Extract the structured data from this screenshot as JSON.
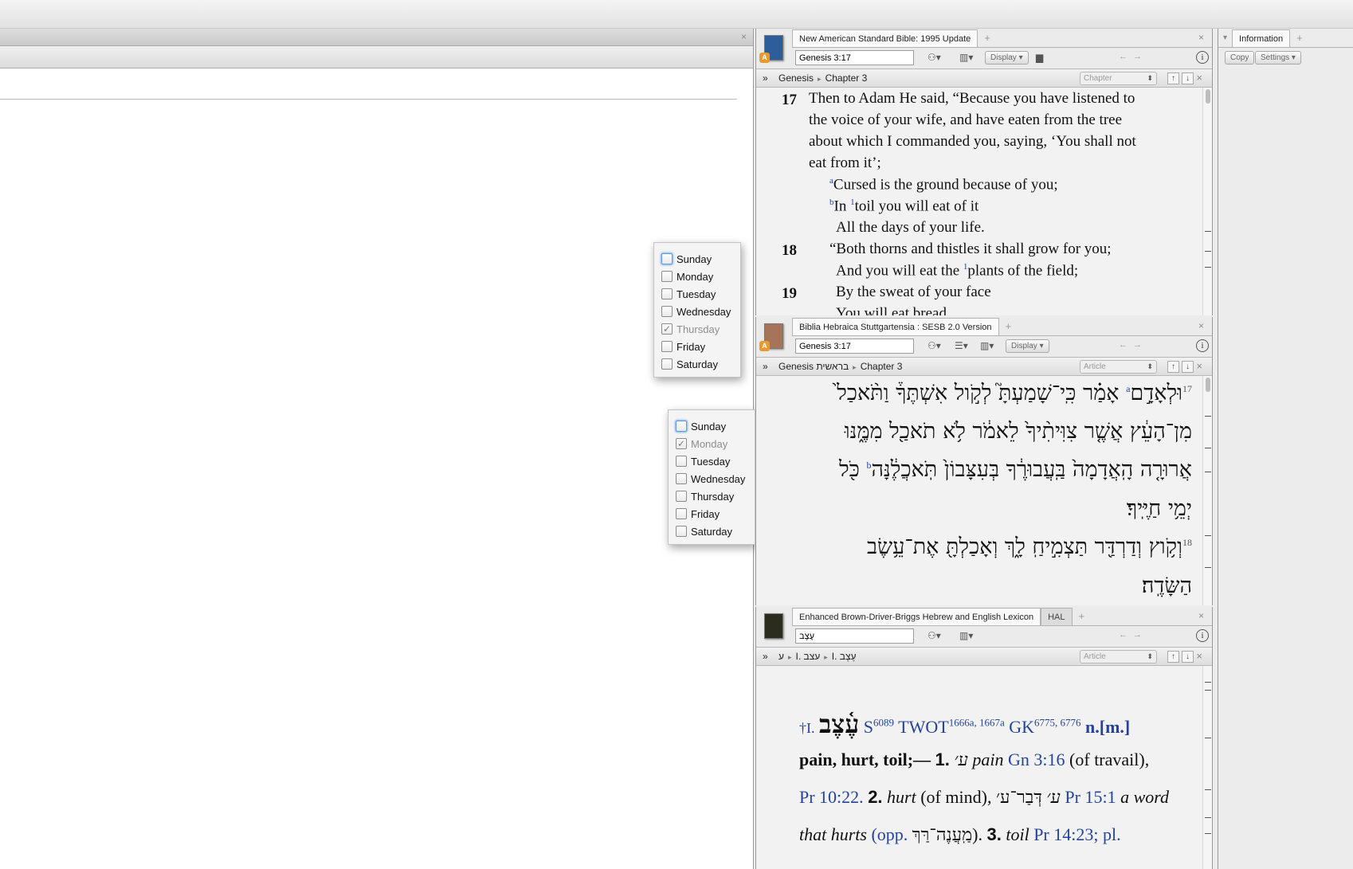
{
  "left_pane": {
    "close": "×"
  },
  "popups": [
    {
      "days": [
        {
          "label": "Sunday",
          "checked": false,
          "focus": true,
          "dim": false
        },
        {
          "label": "Monday",
          "checked": false,
          "focus": false,
          "dim": false
        },
        {
          "label": "Tuesday",
          "checked": false,
          "focus": false,
          "dim": false
        },
        {
          "label": "Wednesday",
          "checked": false,
          "focus": false,
          "dim": false
        },
        {
          "label": "Thursday",
          "checked": true,
          "focus": false,
          "dim": true
        },
        {
          "label": "Friday",
          "checked": false,
          "focus": false,
          "dim": false
        },
        {
          "label": "Saturday",
          "checked": false,
          "focus": false,
          "dim": false
        }
      ]
    },
    {
      "days": [
        {
          "label": "Sunday",
          "checked": false,
          "focus": true,
          "dim": false
        },
        {
          "label": "Monday",
          "checked": true,
          "focus": false,
          "dim": true
        },
        {
          "label": "Tuesday",
          "checked": false,
          "focus": false,
          "dim": false
        },
        {
          "label": "Wednesday",
          "checked": false,
          "focus": false,
          "dim": false
        },
        {
          "label": "Thursday",
          "checked": false,
          "focus": false,
          "dim": false
        },
        {
          "label": "Friday",
          "checked": false,
          "focus": false,
          "dim": false
        },
        {
          "label": "Saturday",
          "checked": false,
          "focus": false,
          "dim": false
        }
      ]
    }
  ],
  "check_glyph": "✓",
  "nasb": {
    "tab": "New American Standard Bible: 1995 Update",
    "ref": "Genesis 3:17",
    "display": "Display ▾",
    "bc_book": "Genesis",
    "bc_chapter": "Chapter 3",
    "selector": "Chapter",
    "v17": "17",
    "v18": "18",
    "v19": "19",
    "l1": "Then to Adam He said, “Because you have listened to",
    "l2": "the voice of your wife, and have eaten from the tree",
    "l3": "about which I commanded you, saying, ‘You shall not",
    "l4": "eat from it’;",
    "sup_a": "a",
    "l5": "Cursed is the ground because of you;",
    "sup_b": "b",
    "l6a": "In ",
    "sup_1": "1",
    "l6b": "toil you will eat of it",
    "l7": "All the days of your life.",
    "l8": "“Both thorns and thistles it shall grow for you;",
    "l9a": "And you will eat the ",
    "sup_1b": "1",
    "l9b": "plants of the field;",
    "l10": "By the sweat of your face",
    "l11": "You will eat bread"
  },
  "bhs": {
    "tab": "Biblia Hebraica Stuttgartensia : SESB 2.0 Version",
    "ref": "Genesis 3:17",
    "display": "Display ▾",
    "bc_book": "Genesis בראשית",
    "bc_chapter": "Chapter 3",
    "selector": "Article",
    "sup17": "17",
    "sup18": "18",
    "sup_a": "a",
    "sup_b": "b",
    "h1": "וּלְאָדָ֣ם",
    "h1b": "אָמַ֗ר כִּֽי־שָׁמַעְתָּ֮ לְקֹ֣ול אִשְׁתֶּךָ֒ וַתֹּ֨אכַל֙",
    "h2": "מִן־הָעֵ֔ץ אֲשֶׁ֤ר צִוִּיתִ֨יךָ֙ לֵאמֹ֔ר לֹ֥א תֹאכַ֖ל מִמֶּ֑נּוּ",
    "h3a": "אֲרוּרָ֤ה הָֽאֲדָמָה֙ בַּֽעֲבוּרֶ֔ךָ בְּעִצָּבוֹן֙ תֹּֽאכֲלֶ֔נָּה",
    "h3b": "כֹּ֖ל",
    "h4": "יְמֵ֥י חַיֶּֽיךָ׃",
    "h5": "וְקֹ֥וץ וְדַרְדַּ֖ר תַּצְמִ֣יחַֽ לָ֑ךְ וְאָכַלְתָּ֖ אֶת־עֵ֥שֶׂב",
    "h6": "הַשָּׂדֶֽה׃"
  },
  "bdb": {
    "tab": "Enhanced Brown-Driver-Briggs Hebrew and English Lexicon",
    "tab2": "HAL",
    "ref": "עֶצֶב",
    "bc_a": "ע",
    "bc_b": "I. עצב",
    "bc_c": "I. עֶצֶב",
    "selector": "Article",
    "dagger": "†I.",
    "headword": "עֶ֫צֶב",
    "s": "S",
    "s_num": "6089",
    "twot": "TWOT",
    "twot_num": "1666a, 1667a",
    "gk": "GK",
    "gk_num": "6775, 6776",
    "nm": "n.[m.]",
    "def1": "pain, hurt, toil;—",
    "n1": "1.",
    "ayin1": "ע׳",
    "pain": "pain",
    "gn": "Gn 3:16",
    "travail": "(of travail),",
    "pr1": "Pr 10:22.",
    "n2": "2.",
    "hurt": "hurt",
    "mind": "(of mind),",
    "ayin2": "ע׳",
    "dbr": "דְּבַר־ע׳",
    "pr2": "Pr 15:1",
    "aword": "a word",
    "that": "that hurts",
    "opp": "(opp.",
    "maaneh": "מַֽעֲנֶה־רַּךְ",
    "closep": ").",
    "n3": "3.",
    "toil": "toil",
    "pr3": "Pr 14:23;",
    "pl": "pl."
  },
  "info": {
    "tab": "Information",
    "copy": "Copy",
    "settings": "Settings ▾"
  },
  "ui": {
    "close": "×",
    "plus": "+",
    "dbl": "»",
    "bc_sep": "▸",
    "info": "i",
    "prev": "←",
    "next": "→",
    "up": "↑",
    "down": "↓"
  }
}
